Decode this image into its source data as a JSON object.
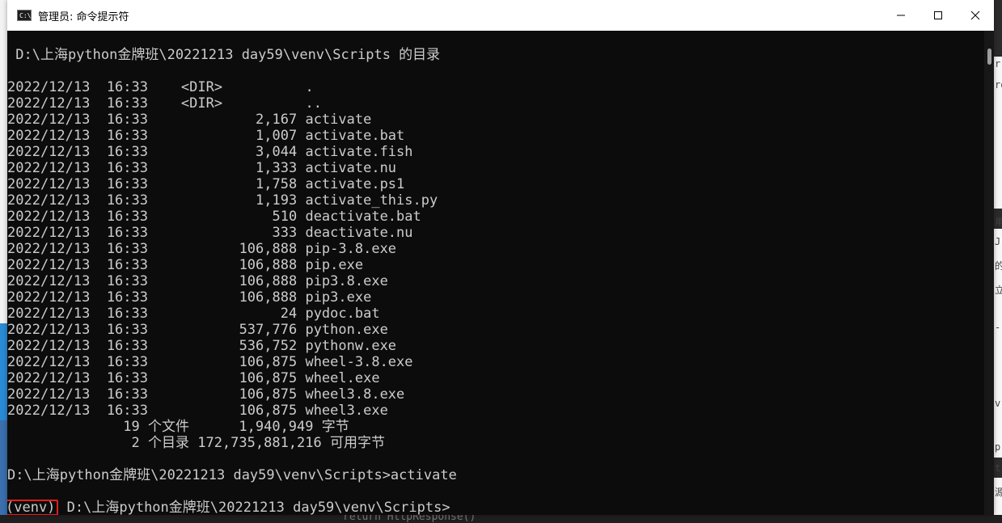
{
  "window": {
    "title": "管理员: 命令提示符",
    "icon_label": "C:\\.",
    "controls": [
      "minimize",
      "maximize",
      "close"
    ]
  },
  "console": {
    "header": " D:\\上海python金牌班\\20221213 day59\\venv\\Scripts 的目录",
    "listing": [
      "2022/12/13  16:33    <DIR>          .",
      "2022/12/13  16:33    <DIR>          ..",
      "2022/12/13  16:33             2,167 activate",
      "2022/12/13  16:33             1,007 activate.bat",
      "2022/12/13  16:33             3,044 activate.fish",
      "2022/12/13  16:33             1,333 activate.nu",
      "2022/12/13  16:33             1,758 activate.ps1",
      "2022/12/13  16:33             1,193 activate_this.py",
      "2022/12/13  16:33               510 deactivate.bat",
      "2022/12/13  16:33               333 deactivate.nu",
      "2022/12/13  16:33           106,888 pip-3.8.exe",
      "2022/12/13  16:33           106,888 pip.exe",
      "2022/12/13  16:33           106,888 pip3.8.exe",
      "2022/12/13  16:33           106,888 pip3.exe",
      "2022/12/13  16:33                24 pydoc.bat",
      "2022/12/13  16:33           537,776 python.exe",
      "2022/12/13  16:33           536,752 pythonw.exe",
      "2022/12/13  16:33           106,875 wheel-3.8.exe",
      "2022/12/13  16:33           106,875 wheel.exe",
      "2022/12/13  16:33           106,875 wheel3.8.exe",
      "2022/12/13  16:33           106,875 wheel3.exe"
    ],
    "summary_files": "              19 个文件      1,940,949 字节",
    "summary_dirs": "               2 个目录 172,735,881,216 可用字节",
    "command_line": "D:\\上海python金牌班\\20221213 day59\\venv\\Scripts>activate",
    "venv_label": "(venv)",
    "prompt": " D:\\上海python金牌班\\20221213 day59\\venv\\Scripts>"
  },
  "background": {
    "bottom_code": "return HttpResponse()",
    "right_glyphs": [
      "r",
      "ro",
      "用",
      "J",
      "的",
      "立",
      "-",
      "v",
      "p",
      "t",
      "源"
    ]
  },
  "colors": {
    "console_bg": "#0c0c0c",
    "console_text": "#cccccc",
    "highlight_border": "#e81b1b",
    "titlebar_bg": "#ffffff"
  }
}
